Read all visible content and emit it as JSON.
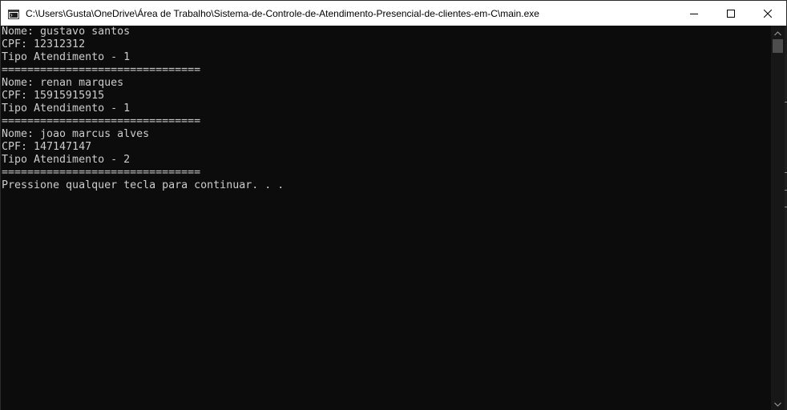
{
  "window": {
    "title": "C:\\Users\\Gusta\\OneDrive\\Área de Trabalho\\Sistema-de-Controle-de-Atendimento-Presencial-de-clientes-em-C\\main.exe",
    "icon": "console-app-icon",
    "controls": {
      "minimize": "minimize-icon",
      "maximize": "maximize-icon",
      "close": "close-icon"
    }
  },
  "console": {
    "lines": [
      "Nome: gustavo santos",
      "CPF: 12312312",
      "Tipo Atendimento - 1",
      "===============================",
      "Nome: renan marques",
      "CPF: 15915915915",
      "Tipo Atendimento - 1",
      "===============================",
      "Nome: joao marcus alves",
      "CPF: 147147147",
      "Tipo Atendimento - 2",
      "===============================",
      "Pressione qualquer tecla para continuar. . ."
    ]
  },
  "colors": {
    "console_bg": "#0c0c0c",
    "console_fg": "#cccccc",
    "titlebar_bg": "#ffffff"
  }
}
